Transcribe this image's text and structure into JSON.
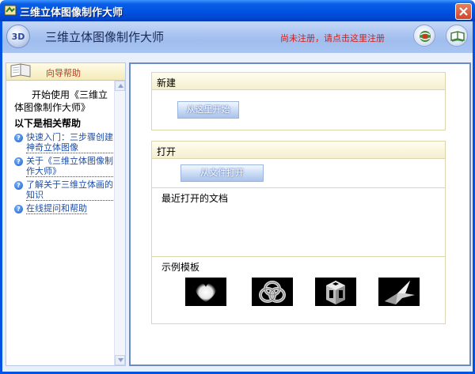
{
  "window": {
    "title": "三维立体图像制作大师"
  },
  "header": {
    "logo_text": "3D",
    "app_name": "三维立体图像制作大师",
    "register_link": "尚未注册，请点击这里注册",
    "buttons": [
      "web-icon",
      "help-book-icon"
    ]
  },
  "help_panel": {
    "tab_label": "向导帮助",
    "intro": "开始使用《三维立体图像制作大师》",
    "subtitle": "以下是相关帮助",
    "links": [
      "快速入门：三步骤创建神奇立体图像",
      "关于《三维立体图像制作大师》",
      "了解关于三维立体画的知识",
      "在线提问和帮助"
    ]
  },
  "main": {
    "new_section": {
      "title": "新建",
      "button_label": "从这里开始"
    },
    "open_section": {
      "title": "打开",
      "button_label": "从文件打开",
      "recent_label": "最近打开的文档",
      "templates_label": "示例模板",
      "templates": [
        "heart-template",
        "knot-template",
        "cube-template",
        "bird-template"
      ]
    }
  },
  "colors": {
    "title_bar": "#0054e3",
    "register_link": "#d0201c",
    "help_link": "#1f4fa8",
    "help_tab_label": "#c0391c"
  }
}
